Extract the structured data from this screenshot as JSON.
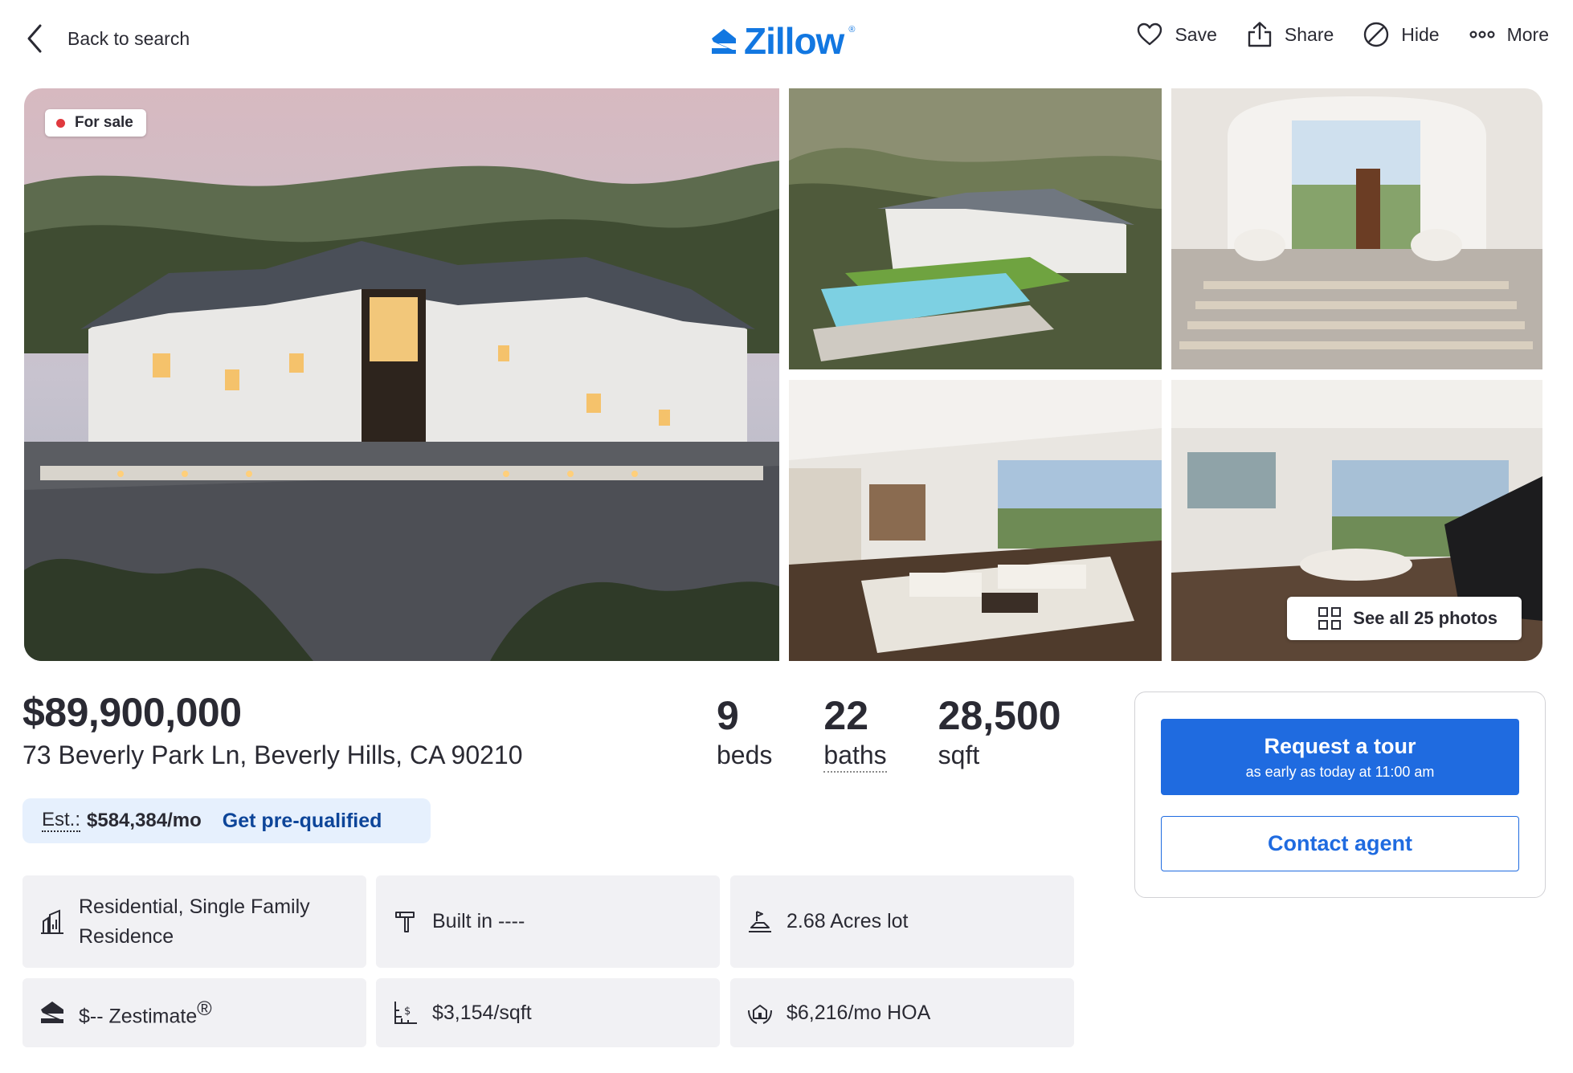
{
  "header": {
    "back_label": "Back to search",
    "logo_text": "Zillow",
    "actions": {
      "save": "Save",
      "share": "Share",
      "hide": "Hide",
      "more": "More"
    }
  },
  "gallery": {
    "status_badge": "For sale",
    "see_all_label": "See all 25 photos",
    "photo_count": 25
  },
  "listing": {
    "price": "$89,900,000",
    "address": "73 Beverly Park Ln, Beverly Hills, CA 90210",
    "beds": "9",
    "beds_label": "beds",
    "baths": "22",
    "baths_label": "baths",
    "sqft": "28,500",
    "sqft_label": "sqft"
  },
  "estimate": {
    "label": "Est.:",
    "value": "$584,384/mo",
    "link": "Get pre-qualified"
  },
  "facts": {
    "type": "Residential, Single Family Residence",
    "built": "Built in ----",
    "lot": "2.68 Acres lot",
    "zestimate": "$-- Zestimate",
    "zestimate_mark": "®",
    "price_per_sqft": "$3,154/sqft",
    "hoa": "$6,216/mo HOA"
  },
  "cta": {
    "tour_label": "Request a tour",
    "tour_sub": "as early as today at 11:00 am",
    "contact_label": "Contact agent"
  },
  "colors": {
    "brand_blue": "#1277e1",
    "button_blue": "#1f6be0",
    "link_navy": "#0d4599",
    "status_red": "#e0393e",
    "est_bg": "#e6f0fd",
    "fact_bg": "#f1f1f4"
  }
}
